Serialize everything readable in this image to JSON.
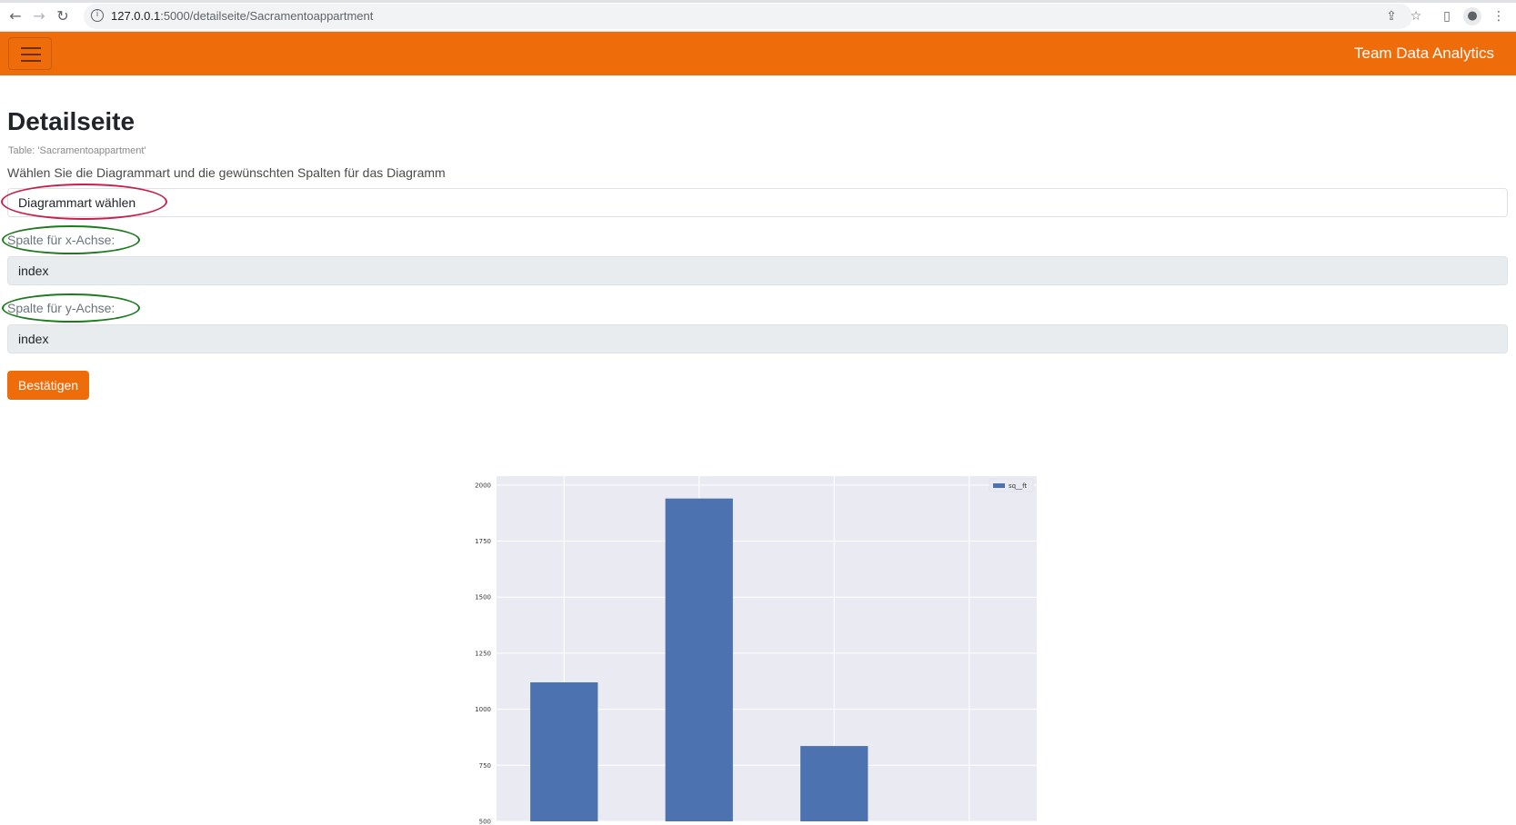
{
  "browser": {
    "url_host": "127.0.0.1",
    "url_path": ":5000/detailseite/Sacramentoappartment"
  },
  "navbar": {
    "brand": "Team Data Analytics",
    "accent_color": "#ef6c0a"
  },
  "page": {
    "title": "Detailseite",
    "table_caption": "Table: 'Sacramentoappartment'",
    "instruction": "Wählen Sie die Diagrammart und die gewünschten Spalten für das Diagramm"
  },
  "form": {
    "chart_type_select": "Diagrammart wählen",
    "x_label": "Spalte für x-Achse:",
    "x_value": "index",
    "y_label": "Spalte für y-Achse:",
    "y_value": "index",
    "submit_label": "Bestätigen"
  },
  "chart_data": {
    "type": "bar",
    "series": [
      {
        "name": "sq__ft",
        "values": [
          1120,
          1940,
          836
        ]
      }
    ],
    "yticks": [
      500,
      750,
      1000,
      1250,
      1500,
      1750,
      2000
    ],
    "ylim": [
      500,
      2040
    ],
    "grid": true,
    "legend": "top-right",
    "bar_color": "#4c72b0",
    "background": "#eaeaf2"
  }
}
